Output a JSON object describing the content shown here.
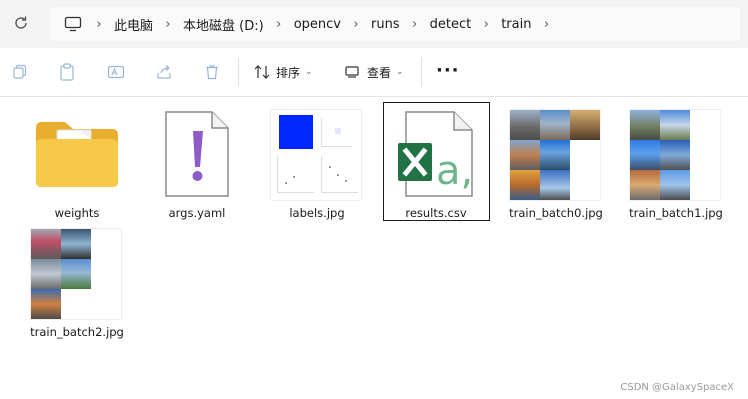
{
  "address_bar": {
    "breadcrumbs": [
      "此电脑",
      "本地磁盘 (D:)",
      "opencv",
      "runs",
      "detect",
      "train"
    ]
  },
  "toolbar": {
    "sort_label": "排序",
    "view_label": "查看",
    "more_label": "···"
  },
  "files": [
    {
      "name": "weights",
      "type": "folder"
    },
    {
      "name": "args.yaml",
      "type": "yaml"
    },
    {
      "name": "labels.jpg",
      "type": "image"
    },
    {
      "name": "results.csv",
      "type": "csv",
      "selected": true
    },
    {
      "name": "train_batch0.jpg",
      "type": "image"
    },
    {
      "name": "train_batch1.jpg",
      "type": "image"
    },
    {
      "name": "train_batch2.jpg",
      "type": "image"
    }
  ],
  "watermark": "CSDN @GalaxySpaceX",
  "colors": {
    "folder_yellow": "#f7c948",
    "exclamation_purple": "#8e5bc8",
    "excel_green": "#217346",
    "labels_blue": "#0027ff"
  }
}
